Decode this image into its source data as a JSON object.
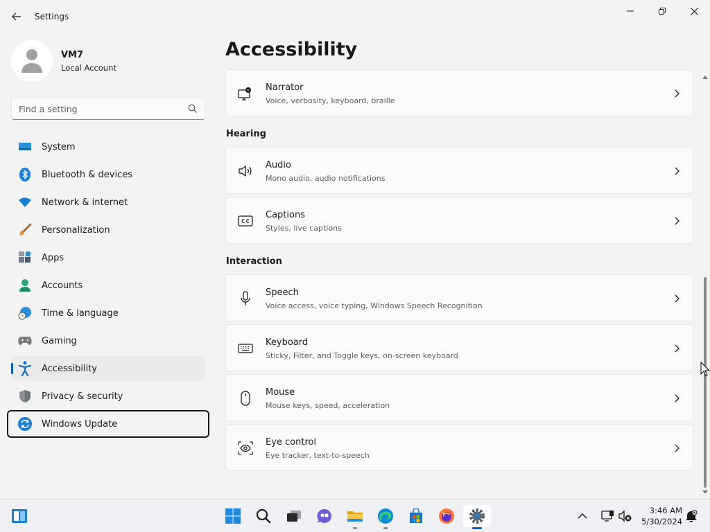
{
  "app": {
    "title": "Settings"
  },
  "profile": {
    "name": "VM7",
    "account_type": "Local Account"
  },
  "search": {
    "placeholder": "Find a setting"
  },
  "nav": [
    {
      "label": "System",
      "icon": "monitor-icon"
    },
    {
      "label": "Bluetooth & devices",
      "icon": "bluetooth-icon"
    },
    {
      "label": "Network & internet",
      "icon": "wifi-icon"
    },
    {
      "label": "Personalization",
      "icon": "brush-icon"
    },
    {
      "label": "Apps",
      "icon": "apps-icon"
    },
    {
      "label": "Accounts",
      "icon": "person-icon"
    },
    {
      "label": "Time & language",
      "icon": "globe-clock-icon"
    },
    {
      "label": "Gaming",
      "icon": "gamepad-icon"
    },
    {
      "label": "Accessibility",
      "icon": "accessibility-icon"
    },
    {
      "label": "Privacy & security",
      "icon": "shield-icon"
    },
    {
      "label": "Windows Update",
      "icon": "sync-icon"
    }
  ],
  "page": {
    "title": "Accessibility"
  },
  "sections": {
    "hearing": "Hearing",
    "interaction": "Interaction"
  },
  "cards": {
    "narrator": {
      "title": "Narrator",
      "desc": "Voice, verbosity, keyboard, braille",
      "icon": "narrator-icon"
    },
    "audio": {
      "title": "Audio",
      "desc": "Mono audio, audio notifications",
      "icon": "speaker-icon"
    },
    "captions": {
      "title": "Captions",
      "desc": "Styles, live captions",
      "icon": "cc-icon"
    },
    "speech": {
      "title": "Speech",
      "desc": "Voice access, voice typing, Windows Speech Recognition",
      "icon": "microphone-icon"
    },
    "keyboard": {
      "title": "Keyboard",
      "desc": "Sticky, Filter, and Toggle keys, on-screen keyboard",
      "icon": "keyboard-icon"
    },
    "mouse": {
      "title": "Mouse",
      "desc": "Mouse keys, speed, acceleration",
      "icon": "mouse-icon"
    },
    "eye_control": {
      "title": "Eye control",
      "desc": "Eye tracker, text-to-speech",
      "icon": "eye-tracker-icon"
    }
  },
  "taskbar": {
    "time": "3:46 AM",
    "date": "5/30/2024"
  },
  "colors": {
    "accent": "#005fb8",
    "background": "#f3f3f3",
    "card": "#fbfbfb"
  }
}
